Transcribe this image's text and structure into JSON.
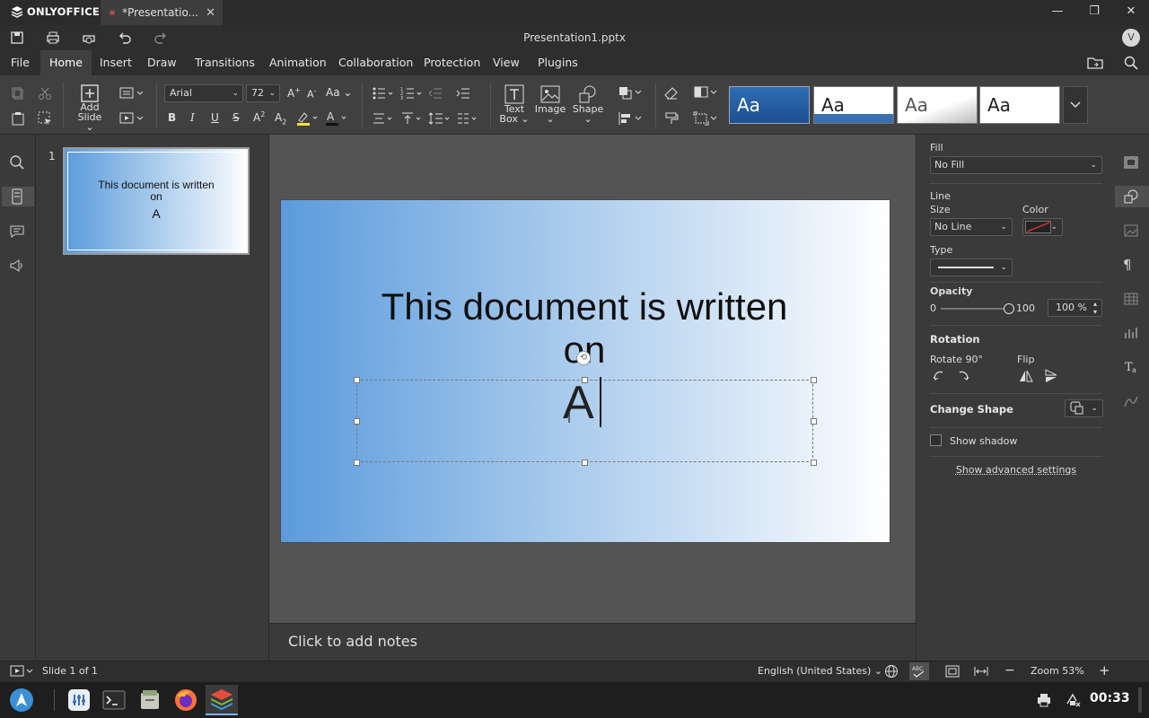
{
  "window": {
    "brand": "ONLYOFFICE",
    "tab_title": "*Presentatio...",
    "doc_title": "Presentation1.pptx",
    "avatar_initial": "V"
  },
  "menu": [
    "File",
    "Home",
    "Insert",
    "Draw",
    "Transitions",
    "Animation",
    "Collaboration",
    "Protection",
    "View",
    "Plugins"
  ],
  "menu_active": "Home",
  "ribbon": {
    "add_slide_line1": "Add",
    "add_slide_line2": "Slide",
    "font_name": "Arial",
    "font_size": "72",
    "text_box_line1": "Text",
    "text_box_line2": "Box",
    "image_label": "Image",
    "shape_label": "Shape",
    "theme_sample": "Aa"
  },
  "slides": {
    "thumb_number": "1",
    "thumb_line1": "This document is written",
    "thumb_line2": "on",
    "thumb_line3": "A"
  },
  "slide": {
    "title_line1": "This document is written",
    "title_line2": "on",
    "body_text": "A"
  },
  "notes": {
    "placeholder": "Click to add notes"
  },
  "panel": {
    "fill_heading": "Fill",
    "fill_value": "No Fill",
    "line_heading": "Line",
    "size_label": "Size",
    "size_value": "No Line",
    "color_label": "Color",
    "type_label": "Type",
    "opacity_heading": "Opacity",
    "opacity_min": "0",
    "opacity_max": "100",
    "opacity_value": "100 %",
    "opacity_level": 1.0,
    "rotation_heading": "Rotation",
    "rotate_label": "Rotate 90°",
    "flip_label": "Flip",
    "change_shape_heading": "Change Shape",
    "show_shadow": "Show shadow",
    "advanced": "Show advanced settings"
  },
  "status": {
    "slide_info": "Slide 1 of 1",
    "language": "English (United States)",
    "zoom": "Zoom 53%"
  },
  "taskbar": {
    "clock": "00:33"
  },
  "colors": {
    "accent": "#7ab3f0",
    "line_color_swatch": "#cc3333",
    "slide_gradient_start": "#5b9bdc",
    "slide_gradient_end": "#ffffff"
  }
}
